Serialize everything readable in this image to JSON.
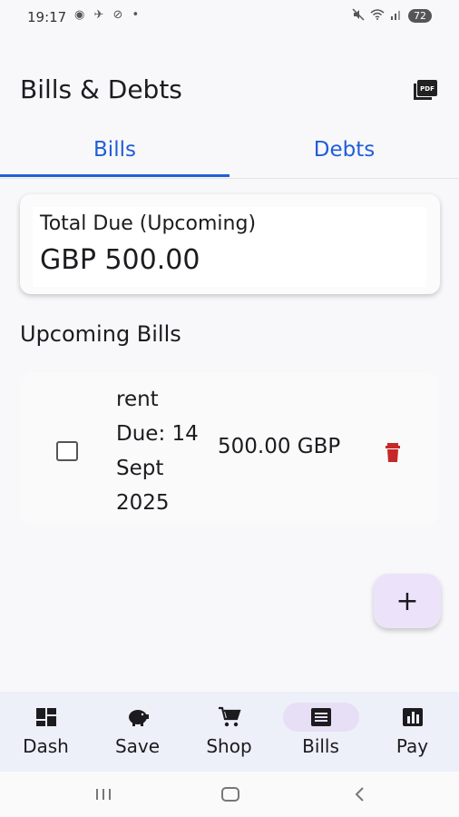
{
  "status": {
    "time": "19:17",
    "left_icons": "◉ ✈ ⊘ •",
    "battery": "72"
  },
  "app": {
    "title": "Bills & Debts",
    "pdf_icon": "pdf-export-icon"
  },
  "tabs": [
    {
      "label": "Bills",
      "active": true
    },
    {
      "label": "Debts",
      "active": false
    }
  ],
  "summary": {
    "label": "Total Due (Upcoming)",
    "amount": "GBP 500.00"
  },
  "section": {
    "title": "Upcoming Bills"
  },
  "bills": [
    {
      "name": "rent",
      "due": "Due: 14 Sept 2025",
      "amount": "500.00 GBP",
      "checked": false
    }
  ],
  "fab": {
    "label": "+"
  },
  "nav": [
    {
      "label": "Dash",
      "icon": "dashboard-icon",
      "active": false
    },
    {
      "label": "Save",
      "icon": "piggy-bank-icon",
      "active": false
    },
    {
      "label": "Shop",
      "icon": "shopping-cart-icon",
      "active": false
    },
    {
      "label": "Bills",
      "icon": "receipt-icon",
      "active": true
    },
    {
      "label": "Pay",
      "icon": "chart-icon",
      "active": false
    }
  ],
  "colors": {
    "accent": "#1f5ed8",
    "delete": "#c62828",
    "fab_bg": "#ece3fb",
    "nav_bg": "#edf0f8"
  }
}
